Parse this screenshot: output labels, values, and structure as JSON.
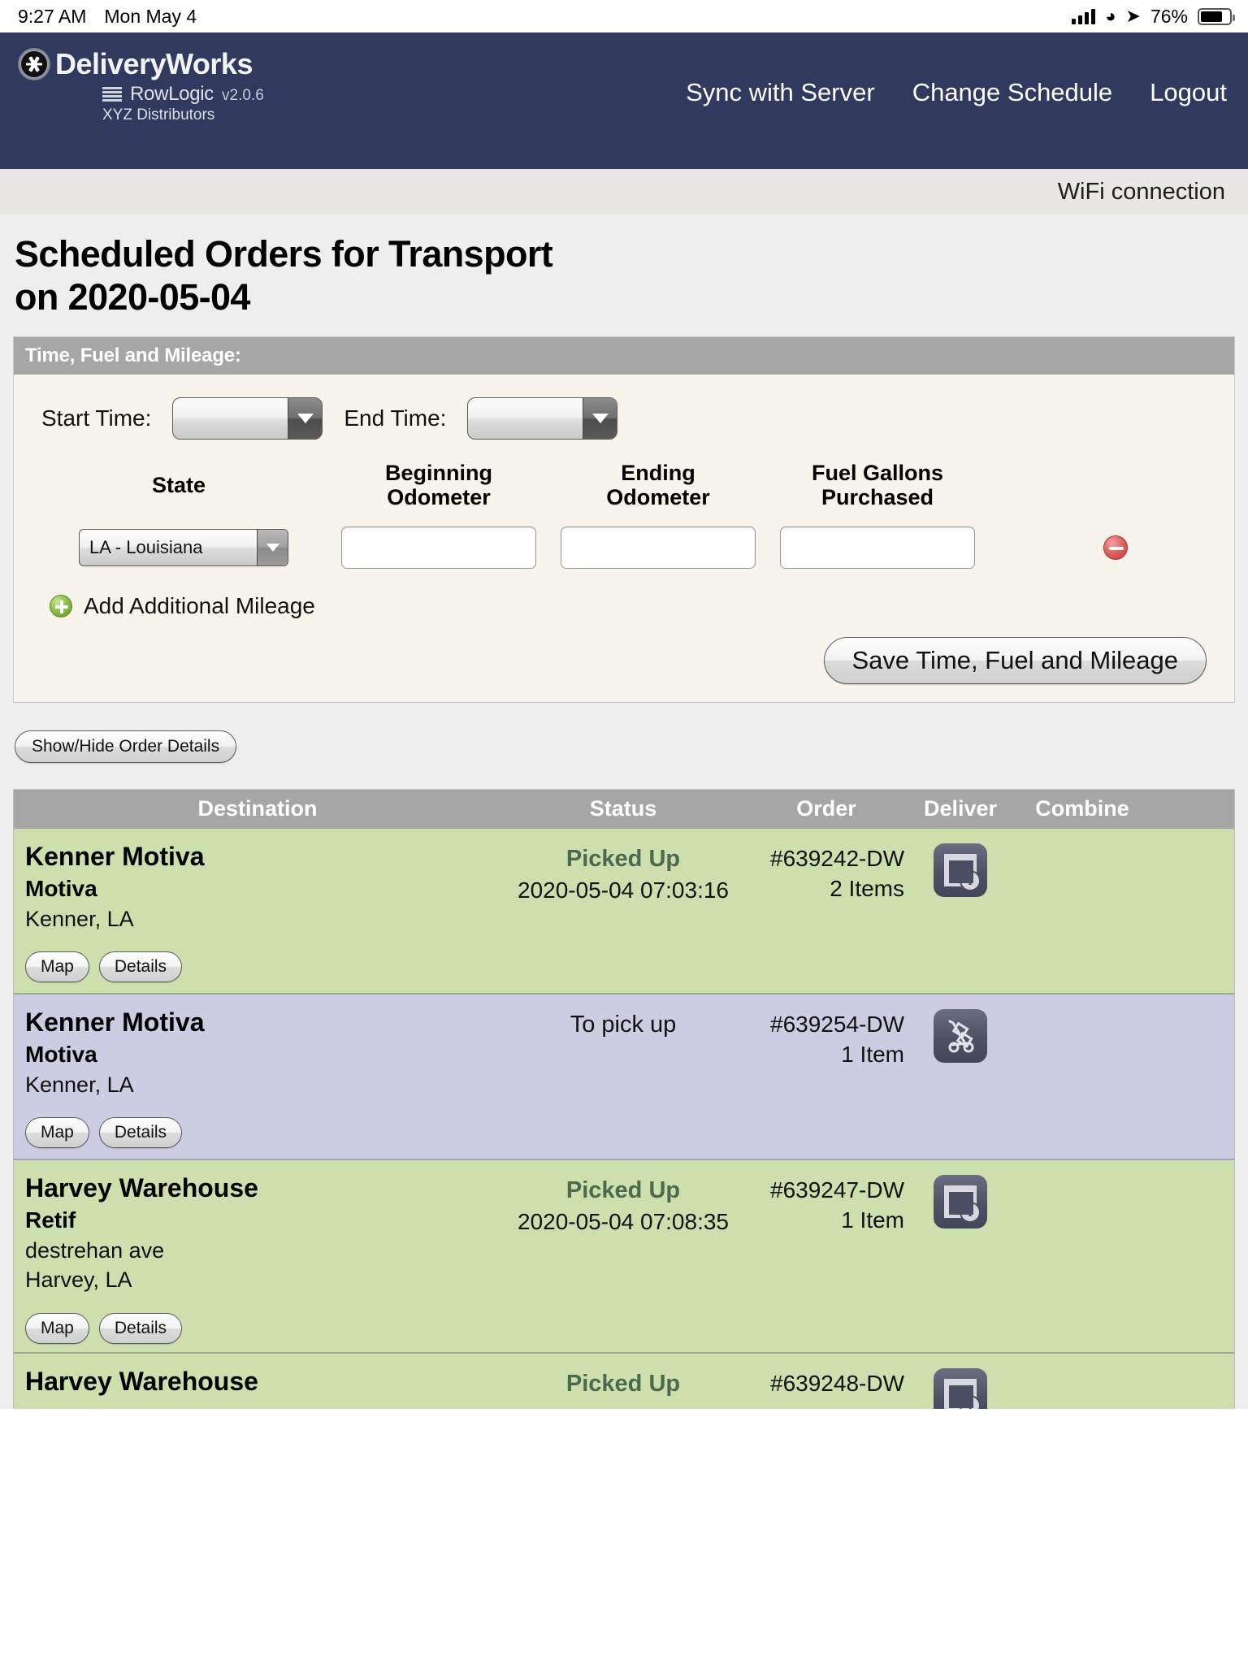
{
  "status_bar": {
    "time": "9:27 AM",
    "date": "Mon May 4",
    "battery_percent": "76%",
    "signal_icon": "cellular-signal-icon",
    "wifi_icon": "wifi-icon",
    "location_icon": "location-arrow-icon",
    "battery_icon": "battery-icon"
  },
  "header": {
    "brand_name": "DeliveryWorks",
    "sub_brand": "RowLogic",
    "version": "v2.0.6",
    "company": "XYZ Distributors",
    "nav": [
      {
        "label": "Sync with Server"
      },
      {
        "label": "Change Schedule"
      },
      {
        "label": "Logout"
      }
    ]
  },
  "connection": {
    "label": "WiFi connection"
  },
  "page": {
    "title_line1": "Scheduled Orders for Transport",
    "title_line2": "on 2020-05-04"
  },
  "panel": {
    "legend": "Time, Fuel and Mileage:",
    "start_time_label": "Start Time:",
    "start_time_value": "",
    "end_time_label": "End Time:",
    "end_time_value": "",
    "columns": {
      "state": "State",
      "beginning_odometer_l1": "Beginning",
      "beginning_odometer_l2": "Odometer",
      "ending_odometer_l1": "Ending",
      "ending_odometer_l2": "Odometer",
      "fuel_gallons_l1": "Fuel Gallons",
      "fuel_gallons_l2": "Purchased"
    },
    "state_value": "LA - Louisiana",
    "beginning_odometer_value": "",
    "ending_odometer_value": "",
    "fuel_gallons_value": "",
    "remove_icon": "remove-circle-icon",
    "add_icon": "add-circle-icon",
    "add_label": "Add Additional Mileage",
    "save_label": "Save Time, Fuel and Mileage"
  },
  "show_hide_label": "Show/Hide Order Details",
  "orders_table": {
    "headers": [
      "Destination",
      "Status",
      "Order",
      "Deliver",
      "Combine"
    ],
    "row_buttons": {
      "map": "Map",
      "details": "Details"
    },
    "rows": [
      {
        "color": "green",
        "destination": "Kenner Motiva",
        "customer": "Motiva",
        "address_lines": [
          "Kenner, LA"
        ],
        "status": "Picked Up",
        "status_time": "2020-05-04 07:03:16",
        "status_style": "picked-up",
        "order_number": "#639242-DW",
        "items": "2 Items",
        "deliver_icon": "order-info-icon"
      },
      {
        "color": "purple",
        "destination": "Kenner Motiva",
        "customer": "Motiva",
        "address_lines": [
          "Kenner, LA"
        ],
        "status": "To pick up",
        "status_time": "",
        "status_style": "to-pick-up",
        "order_number": "#639254-DW",
        "items": "1 Item",
        "deliver_icon": "hand-truck-icon"
      },
      {
        "color": "green",
        "destination": "Harvey Warehouse",
        "customer": "Retif",
        "address_lines": [
          "destrehan ave",
          "Harvey, LA"
        ],
        "status": "Picked Up",
        "status_time": "2020-05-04 07:08:35",
        "status_style": "picked-up",
        "order_number": "#639247-DW",
        "items": "1 Item",
        "deliver_icon": "order-info-icon"
      },
      {
        "color": "green",
        "destination": "Harvey Warehouse",
        "customer": "",
        "address_lines": [],
        "status": "Picked Up",
        "status_time": "",
        "status_style": "picked-up",
        "order_number": "#639248-DW",
        "items": "",
        "deliver_icon": "order-info-icon"
      }
    ]
  }
}
